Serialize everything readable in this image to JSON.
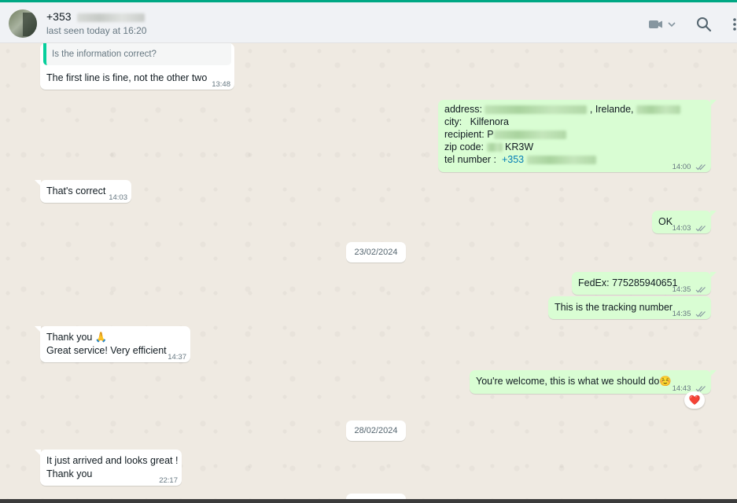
{
  "header": {
    "contact_name": "+353",
    "status": "last seen today at 16:20",
    "icons": [
      "avatar",
      "video-call-icon",
      "chevron-down-icon",
      "search-icon",
      "menu-icon"
    ]
  },
  "messages": [
    {
      "id": "m1",
      "direction": "in",
      "quoted": "Is the information correct?",
      "text": "The first line is fine, not the other two",
      "time": "13:48"
    },
    {
      "id": "m2",
      "direction": "out",
      "lines": {
        "address_label": "address:",
        "address_visible": ", Irelande,",
        "city_label": "city:",
        "city_value": "Kilfenora",
        "recipient_label": "recipient:",
        "recipient_visible": "P",
        "zip_label": "zip code:",
        "zip_visible": "KR3W",
        "tel_label": "tel number :",
        "tel_value": "+353"
      },
      "time": "14:00"
    },
    {
      "id": "m3",
      "direction": "in",
      "text": "That's correct",
      "time": "14:03"
    },
    {
      "id": "m4",
      "direction": "out",
      "text": "OK",
      "time": "14:03"
    },
    {
      "id": "m5",
      "direction": "out",
      "text": "FedEx: 775285940651",
      "time": "14:35"
    },
    {
      "id": "m6",
      "direction": "out",
      "text": "This is the tracking number",
      "time": "14:35"
    },
    {
      "id": "m7",
      "direction": "in",
      "line1": "Thank you 🙏",
      "line2": "Great service! Very efficient",
      "time": "14:37"
    },
    {
      "id": "m8",
      "direction": "out",
      "text": "You're welcome, this is what we should do☺️",
      "time": "14:43",
      "reaction": "❤️"
    },
    {
      "id": "m9",
      "direction": "in",
      "line1": "It just arrived and looks great !",
      "line2": "Thank you",
      "time": "22:17"
    }
  ],
  "dates": [
    "23/02/2024",
    "28/02/2024"
  ],
  "colors": {
    "accent": "#00a884",
    "incoming": "#ffffff",
    "outgoing": "#d9fdd3",
    "read_ticks": "#8696a0",
    "background": "#efeae2"
  }
}
